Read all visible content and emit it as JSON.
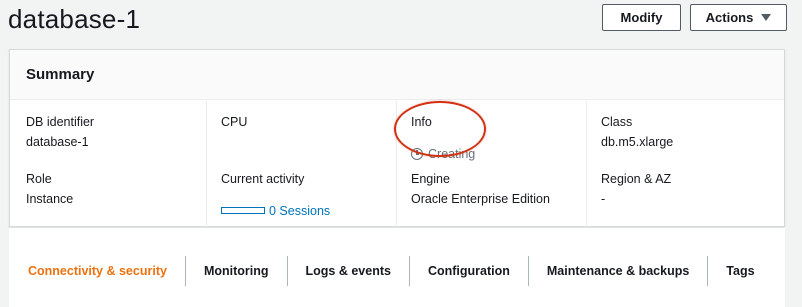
{
  "header": {
    "title": "database-1",
    "modify_label": "Modify",
    "actions_label": "Actions"
  },
  "summary": {
    "title": "Summary",
    "fields": {
      "db_identifier": {
        "label": "DB identifier",
        "value": "database-1"
      },
      "cpu": {
        "label": "CPU",
        "value": ""
      },
      "info": {
        "label": "Info",
        "value": "Creating"
      },
      "class": {
        "label": "Class",
        "value": "db.m5.xlarge"
      },
      "role": {
        "label": "Role",
        "value": "Instance"
      },
      "current_activity": {
        "label": "Current activity",
        "value": "0 Sessions"
      },
      "engine": {
        "label": "Engine",
        "value": "Oracle Enterprise Edition"
      },
      "region_az": {
        "label": "Region & AZ",
        "value": "-"
      }
    }
  },
  "tabs": [
    {
      "label": "Connectivity & security",
      "active": true
    },
    {
      "label": "Monitoring",
      "active": false
    },
    {
      "label": "Logs & events",
      "active": false
    },
    {
      "label": "Configuration",
      "active": false
    },
    {
      "label": "Maintenance & backups",
      "active": false
    },
    {
      "label": "Tags",
      "active": false
    }
  ],
  "colors": {
    "accent": "#ec7211",
    "link": "#0073bb",
    "highlight": "#d13212",
    "status_pending": "#687078"
  }
}
